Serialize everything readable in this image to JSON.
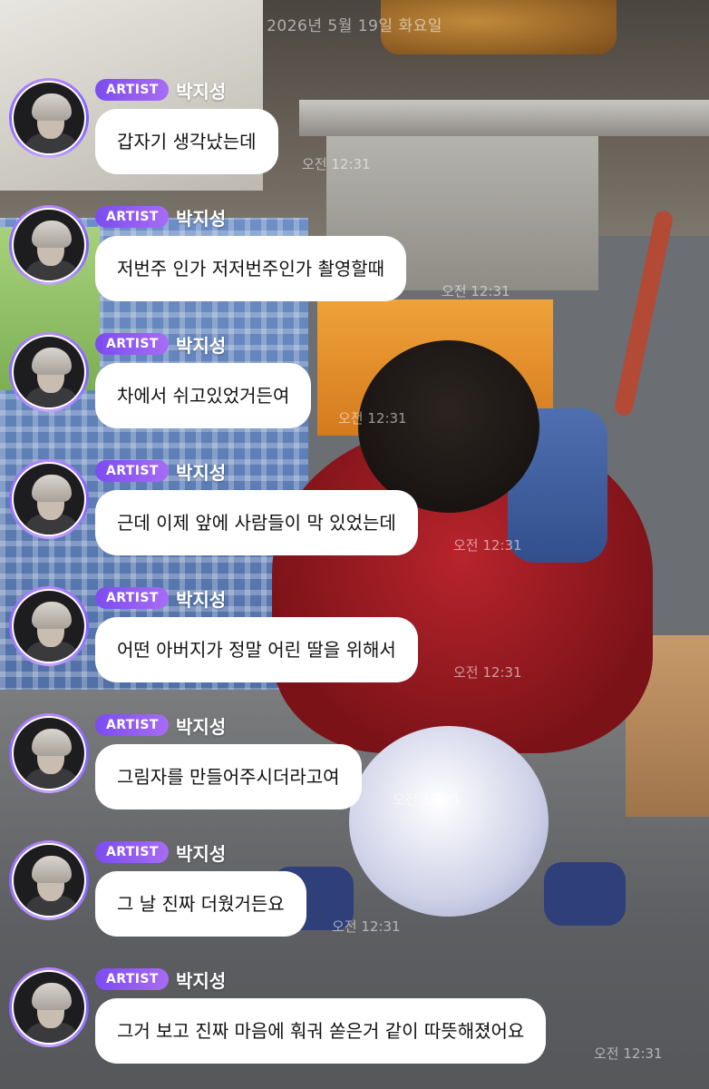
{
  "date_header": "2026년 5월 19일 화요일",
  "badge_label": "ARTIST",
  "messages": [
    {
      "name": "박지성",
      "text": "갑자기 생각났는데",
      "time": "오전 12:31"
    },
    {
      "name": "박지성",
      "text": "저번주 인가 저저번주인가 촬영할때",
      "time": "오전 12:31"
    },
    {
      "name": "박지성",
      "text": "차에서 쉬고있었거든여",
      "time": "오전 12:31"
    },
    {
      "name": "박지성",
      "text": "근데 이제 앞에 사람들이 막 있었는데",
      "time": "오전 12:31"
    },
    {
      "name": "박지성",
      "text": "어떤 아버지가 정말 어린 딸을 위해서",
      "time": "오전 12:31"
    },
    {
      "name": "박지성",
      "text": "그림자를 만들어주시더라고여",
      "time": "오전 12:31"
    },
    {
      "name": "박지성",
      "text": "그 날 진짜 더웠거든요",
      "time": "오전 12:31"
    },
    {
      "name": "박지성",
      "text": "그거 보고 진짜 마음에 훠궈 쏟은거 같이 따뜻해졌어요",
      "time": "오전 12:31"
    }
  ]
}
